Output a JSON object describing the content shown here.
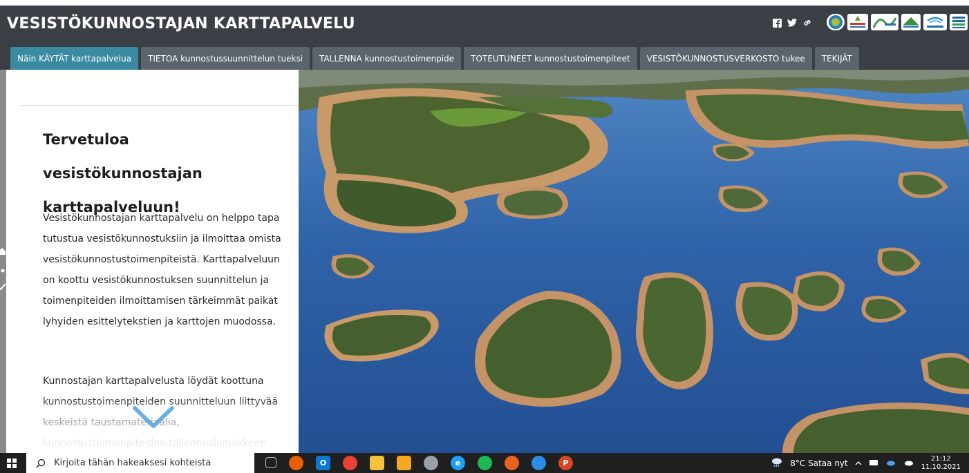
{
  "header": {
    "title": "VESISTÖKUNNOSTAJAN KARTTAPALVELU",
    "social_icons": [
      "facebook-icon",
      "twitter-icon",
      "link-icon"
    ],
    "logos": [
      "logo-1",
      "logo-2",
      "logo-3",
      "logo-4",
      "logo-syke",
      "logo-5",
      "logo-6"
    ]
  },
  "tabs": [
    {
      "label": "Näin KÄYTÄT karttapalvelua",
      "active": true
    },
    {
      "label": "TIETOA kunnostussuunnittelun tueksi",
      "active": false
    },
    {
      "label": "TALLENNA kunnostustoimenpide",
      "active": false
    },
    {
      "label": "TOTEUTUNEET kunnostustoimenpiteet",
      "active": false
    },
    {
      "label": "VESISTÖKUNNOSTUSVERKOSTO tukee",
      "active": false
    },
    {
      "label": "TEKIJÄT",
      "active": false
    }
  ],
  "panel": {
    "heading": "Tervetuloa vesistökunnostajan karttapalveluun!",
    "paragraph1": "Vesistökunnostajan karttapalvelu on helppo tapa tutustua vesistökunnostuksiin ja ilmoittaa omista vesistökunnostustoimenpiteistä. Karttapalveluun on koottu vesistökunnostuksen suunnittelun ja toimenpiteiden ilmoittamisen tärkeimmät paikat lyhyiden esittelytekstien ja karttojen muodossa.",
    "paragraph2": "Kunnostajan karttapalvelusta löydät koottuna kunnostustoimenpiteiden suunnitteluun liittyvää keskeistä taustamateriaalia, kunnostustoimenpiteiden tallennuslomakkeen"
  },
  "taskbar": {
    "search_placeholder": "Kirjoita tähän hakeaksesi kohteista",
    "weather": "8°C  Sataa nyt",
    "time": "21:12",
    "date": "11.10.2021"
  },
  "colors": {
    "header_bg": "#3a3f45",
    "active_tab": "#3a8ba2",
    "tab_bg": "#5b646c",
    "chevron": "#5aa7e0"
  }
}
